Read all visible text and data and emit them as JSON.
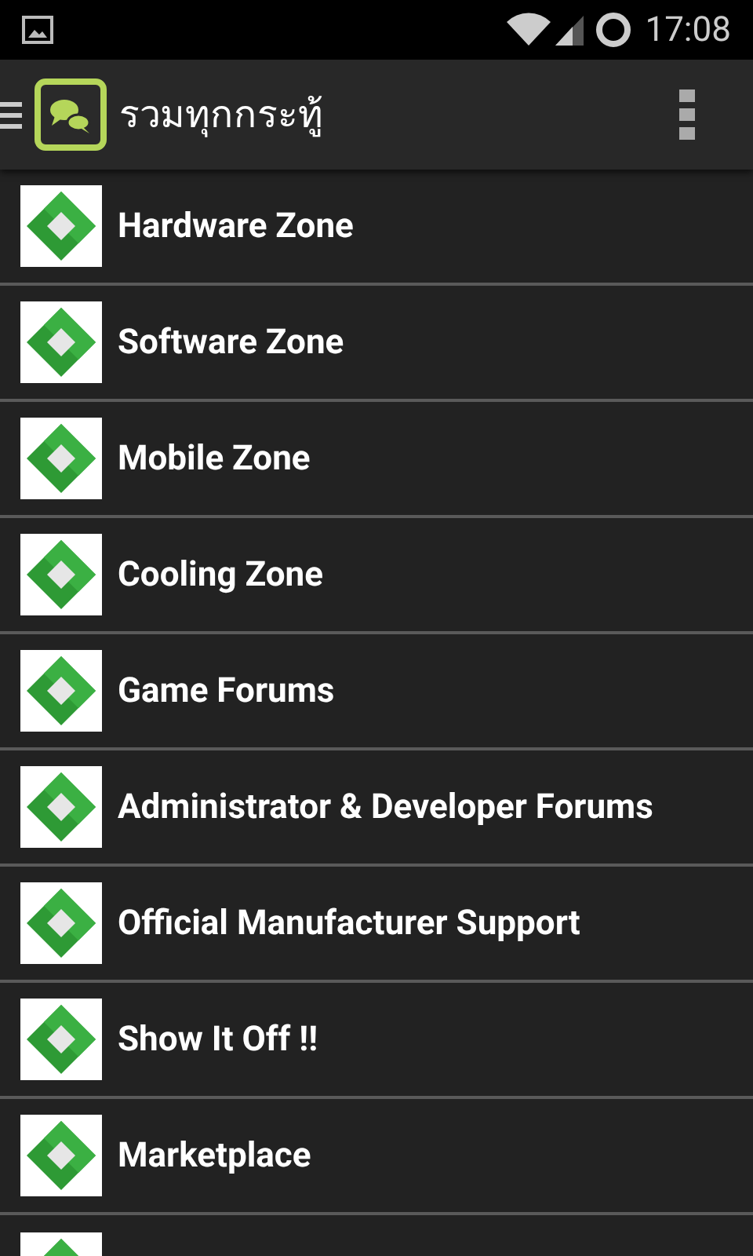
{
  "status_bar": {
    "time": "17:08"
  },
  "app_bar": {
    "title": "รวมทุกกระทู้"
  },
  "forums": [
    {
      "kind": "row",
      "label": "Hardware Zone"
    },
    {
      "kind": "row",
      "label": "Software Zone"
    },
    {
      "kind": "row",
      "label": "Mobile Zone"
    },
    {
      "kind": "row",
      "label": "Cooling Zone"
    },
    {
      "kind": "row",
      "label": "Game Forums"
    },
    {
      "kind": "row",
      "label": "Administrator & Developer Forums"
    },
    {
      "kind": "row",
      "label": "Official Manufacturer Support"
    },
    {
      "kind": "row",
      "label": "Show It Off !!"
    },
    {
      "kind": "row",
      "label": "Marketplace"
    },
    {
      "kind": "cut"
    }
  ]
}
